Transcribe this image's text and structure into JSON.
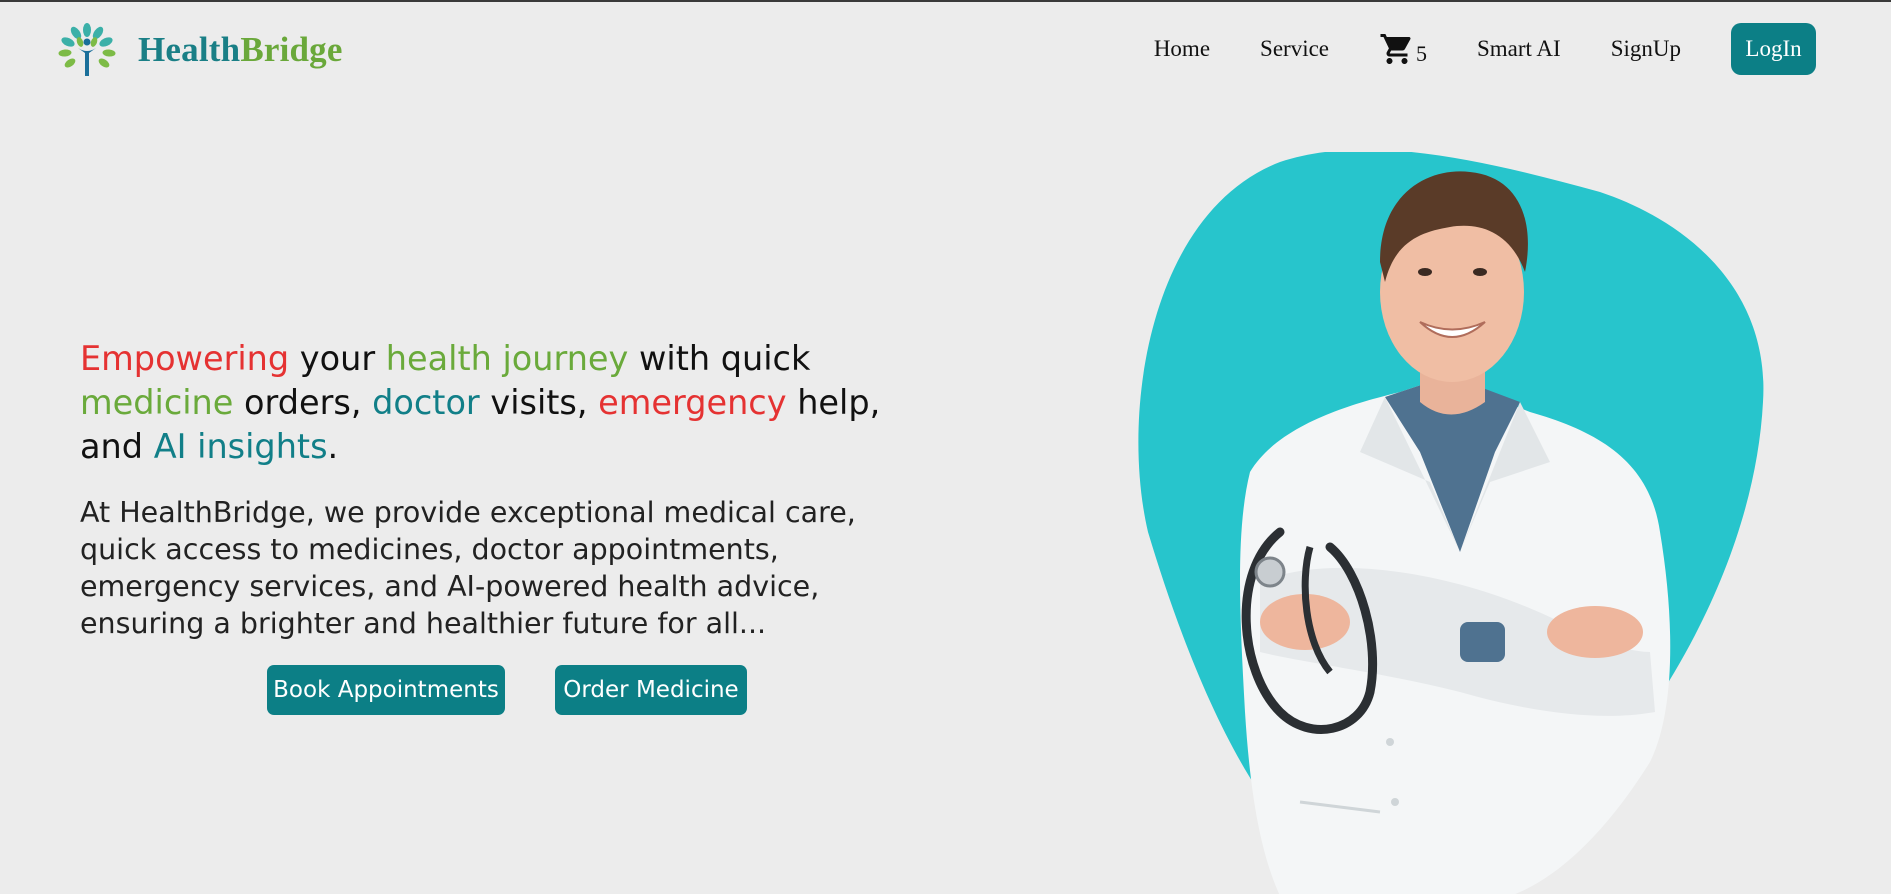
{
  "brand": {
    "name_part1": "Health",
    "name_part2": "Bridge",
    "logo_icon": "tree-person-logo"
  },
  "nav": {
    "home": "Home",
    "service": "Service",
    "cart_icon": "shopping-cart-icon",
    "cart_count": "5",
    "smart_ai": "Smart AI",
    "signup": "SignUp",
    "login": "LogIn"
  },
  "hero": {
    "heading": {
      "w1": "Empowering",
      "w2": " your ",
      "w3": "health journey",
      "w4": " with quick",
      "w5": "medicine",
      "w6": " orders, ",
      "w7": "doctor",
      "w8": " visits, ",
      "w9": "emergency",
      "w10": " help,",
      "w11": "and ",
      "w12": "AI insights",
      "w13": "."
    },
    "description": "At HealthBridge, we provide exceptional medical care, quick access to medicines, doctor appointments, emergency services, and AI-powered health advice, ensuring a brighter and healthier future for all...",
    "book_button": "Book Appointments",
    "order_button": "Order Medicine",
    "image_alt": "doctor-with-stethoscope-image"
  },
  "colors": {
    "teal": "#0c7f86",
    "green": "#6aaa3b",
    "red": "#e53232",
    "blob": "#27c5cc",
    "background": "#ececec"
  }
}
